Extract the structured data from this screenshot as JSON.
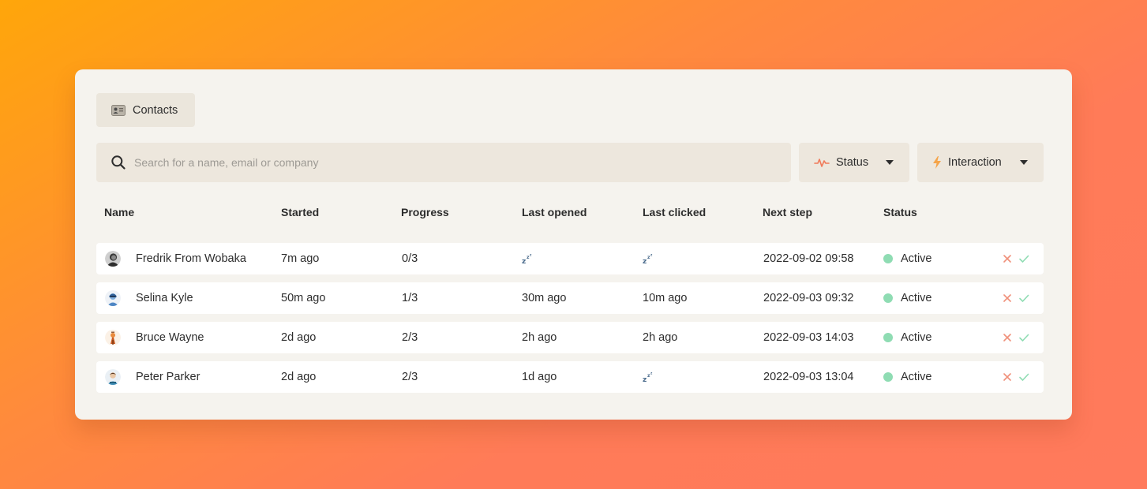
{
  "toolbar": {
    "contacts_label": "Contacts",
    "search_placeholder": "Search for a name, email or company",
    "status_filter_label": "Status",
    "interaction_filter_label": "Interaction"
  },
  "table": {
    "columns": [
      "Name",
      "Started",
      "Progress",
      "Last opened",
      "Last clicked",
      "Next step",
      "Status"
    ],
    "rows": [
      {
        "name": "Fredrik From Wobaka",
        "started": "7m ago",
        "progress": "0/3",
        "last_opened": "",
        "last_opened_icon": "sleeping-icon",
        "last_clicked": "",
        "last_clicked_icon": "sleeping-icon",
        "next_step": "2022-09-02 09:58",
        "status": "Active"
      },
      {
        "name": "Selina Kyle",
        "started": "50m ago",
        "progress": "1/3",
        "last_opened": "30m ago",
        "last_clicked": "10m ago",
        "next_step": "2022-09-03 09:32",
        "status": "Active"
      },
      {
        "name": "Bruce Wayne",
        "started": "2d ago",
        "progress": "2/3",
        "last_opened": "2h ago",
        "last_clicked": "2h ago",
        "next_step": "2022-09-03 14:03",
        "status": "Active"
      },
      {
        "name": "Peter Parker",
        "started": "2d ago",
        "progress": "2/3",
        "last_opened": "1d ago",
        "last_clicked": "",
        "last_clicked_icon": "sleeping-icon",
        "next_step": "2022-09-03 13:04",
        "status": "Active"
      }
    ]
  },
  "colors": {
    "status_active": "#8fdcb3",
    "reject": "#f0907a",
    "accept": "#8fdcb3",
    "pulse_icon": "#f07a5a",
    "bolt_icon": "#f5a54a"
  }
}
